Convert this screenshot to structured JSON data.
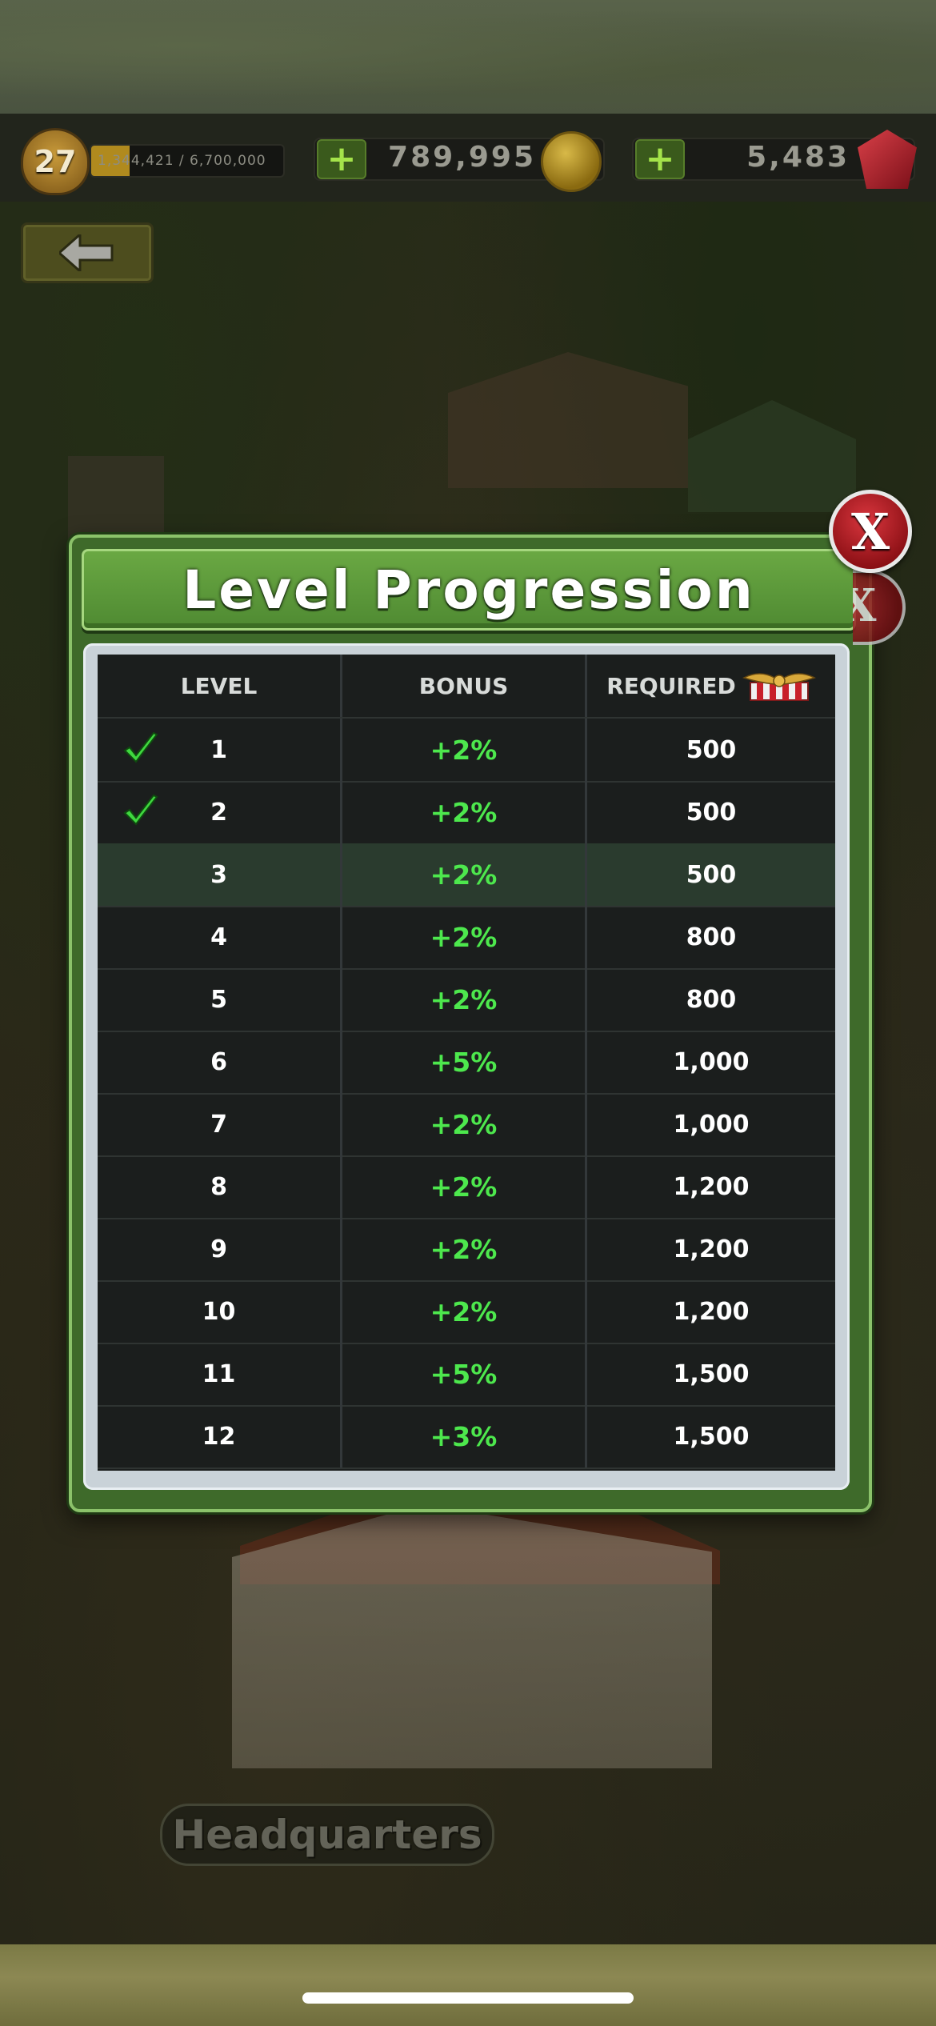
{
  "hud": {
    "rank_level": "27",
    "xp_text": "1,344,421 / 6,700,000",
    "xp_progress": 0.2,
    "coins": "789,995",
    "gems": "5,483",
    "coin_icon": "gold-coin-icon",
    "gem_icon": "ruby-icon"
  },
  "building": {
    "name": "Headquarters"
  },
  "modal": {
    "title": "Level Progression",
    "close_label": "X",
    "headers": {
      "level": "LEVEL",
      "bonus": "BONUS",
      "required": "REQUIRED"
    },
    "required_icon": "medal-icon",
    "rows": [
      {
        "level": "1",
        "bonus": "+2%",
        "required": "500",
        "completed": true
      },
      {
        "level": "2",
        "bonus": "+2%",
        "required": "500",
        "completed": true
      },
      {
        "level": "3",
        "bonus": "+2%",
        "required": "500",
        "completed": false,
        "current": true
      },
      {
        "level": "4",
        "bonus": "+2%",
        "required": "800",
        "completed": false
      },
      {
        "level": "5",
        "bonus": "+2%",
        "required": "800",
        "completed": false
      },
      {
        "level": "6",
        "bonus": "+5%",
        "required": "1,000",
        "completed": false
      },
      {
        "level": "7",
        "bonus": "+2%",
        "required": "1,000",
        "completed": false
      },
      {
        "level": "8",
        "bonus": "+2%",
        "required": "1,200",
        "completed": false
      },
      {
        "level": "9",
        "bonus": "+2%",
        "required": "1,200",
        "completed": false
      },
      {
        "level": "10",
        "bonus": "+2%",
        "required": "1,200",
        "completed": false
      },
      {
        "level": "11",
        "bonus": "+5%",
        "required": "1,500",
        "completed": false
      },
      {
        "level": "12",
        "bonus": "+3%",
        "required": "1,500",
        "completed": false
      }
    ]
  },
  "colors": {
    "accent_green": "#4de84d",
    "modal_green": "#4f8a32",
    "close_red": "#c0232a"
  }
}
